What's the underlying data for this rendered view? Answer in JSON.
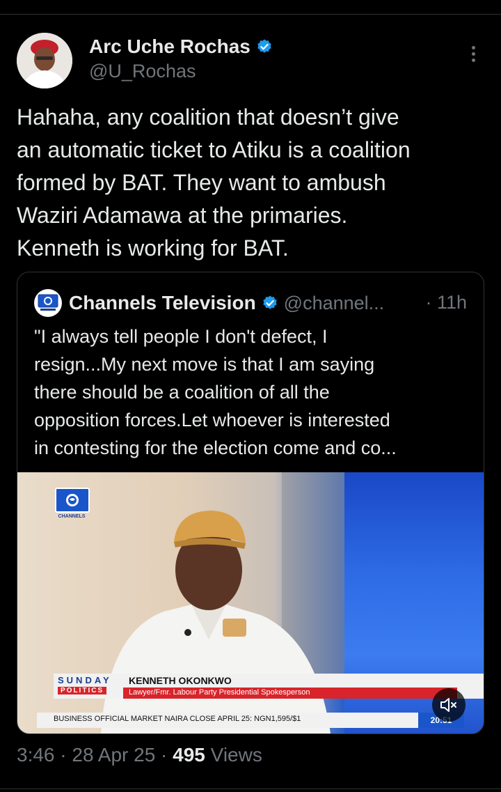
{
  "tweet": {
    "author": {
      "name": "Arc Uche Rochas",
      "handle": "@U_Rochas",
      "verified_icon": "verified-badge-icon"
    },
    "text_lines": [
      "Hahaha, any coalition that doesn’t give",
      "an automatic ticket to Atiku is a coalition",
      "formed by BAT. They want to ambush",
      "Waziri Adamawa at the primaries.",
      "Kenneth is working for BAT."
    ],
    "meta": {
      "time": "3:46",
      "date": "28 Apr 25",
      "views_count": "495",
      "views_label": "Views"
    }
  },
  "quote": {
    "name": "Channels Television",
    "handle": "@channel...",
    "time": "· 11h",
    "text_lines": [
      "\"I always tell people I don't defect, I",
      "resign...My next move is that I am saying",
      "there should be a coalition of all the",
      "opposition forces.Let whoever is interested",
      "in contesting for the election come and co..."
    ],
    "media": {
      "watermark": "CHANNELS",
      "show_line1": "SUNDAY",
      "show_line2": "POLITICS",
      "guest_name": "KENNETH OKONKWO",
      "guest_role": "Lawyer/Fmr. Labour Party Presidential Spokesperson",
      "ticker": "BUSINESS     OFFICIAL MARKET NAIRA CLOSE APRIL 25: NGN1,595/$1",
      "clock": "20:51"
    }
  },
  "colors": {
    "background": "#000000",
    "text": "#e7e9ea",
    "secondary": "#71767b",
    "verified": "#1d9bf0",
    "divider": "#2f3336"
  }
}
